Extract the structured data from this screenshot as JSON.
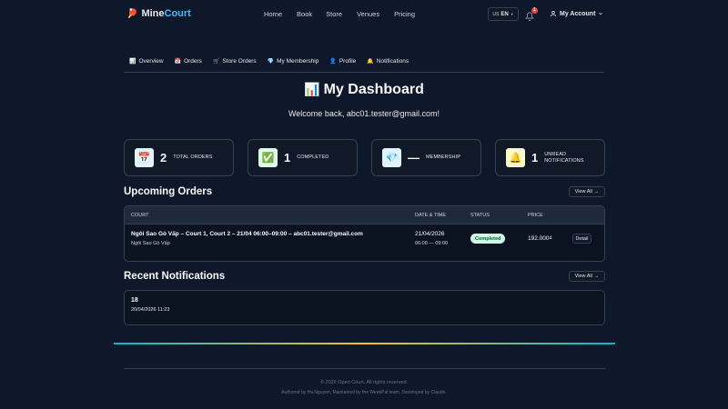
{
  "brand": {
    "mine": "Mine",
    "court": "Court",
    "icon": "ping-pong-icon"
  },
  "nav": {
    "home": "Home",
    "book": "Book",
    "store": "Store",
    "venues": "Venues",
    "pricing": "Pricing"
  },
  "lang": {
    "flag": "US",
    "code": "EN"
  },
  "notifications_badge": "1",
  "account": {
    "label": "My Account"
  },
  "tabs": [
    {
      "icon": "📊",
      "label": "Overview"
    },
    {
      "icon": "📅",
      "label": "Orders"
    },
    {
      "icon": "🛒",
      "label": "Store Orders"
    },
    {
      "icon": "💎",
      "label": "My Membership"
    },
    {
      "icon": "👤",
      "label": "Profile"
    },
    {
      "icon": "🔔",
      "label": "Notifications"
    }
  ],
  "title": {
    "icon": "📊",
    "text": "My Dashboard"
  },
  "welcome": "Welcome back, abc01.tester@gmail.com!",
  "stats": [
    {
      "icon": "📅",
      "value": "2",
      "label": "TOTAL ORDERS"
    },
    {
      "icon": "✅",
      "value": "1",
      "label": "COMPLETED"
    },
    {
      "icon": "💎",
      "value": "—",
      "label": "MEMBERSHIP"
    },
    {
      "icon": "🔔",
      "value": "1",
      "label_line1": "UNREAD",
      "label_line2": "NOTIFICATIONS"
    }
  ],
  "upcoming": {
    "title": "Upcoming Orders",
    "view_all": "View All",
    "columns": {
      "court": "COURT",
      "datetime": "DATE & TIME",
      "status": "STATUS",
      "price": "PRICE"
    },
    "rows": [
      {
        "court": "Ngôi Sao Gò Vấp – Court 1, Court 2 – 21/04 06:00–09:00 – abc01.tester@gmail.com",
        "venue": "Ngôi Sao Gò Vấp",
        "date": "21/04/2026",
        "time": "06:00 — 09:00",
        "status": "Completed",
        "price": "192.000₫",
        "action": "Detail"
      }
    ]
  },
  "recent": {
    "title": "Recent Notifications",
    "view_all": "View All",
    "items": [
      {
        "title": "18",
        "time": "20/04/2026 11:23"
      }
    ]
  },
  "footer": {
    "copyright": "© 2026 Open Court. All rights reserved.",
    "authored": "Authored by Ha Nguyen, Maintained by the WeekPal team, Developed by Claude."
  },
  "colors": {
    "background": "#0f172a",
    "accent": "#38bdf8",
    "status_completed": "#d1fae5"
  }
}
